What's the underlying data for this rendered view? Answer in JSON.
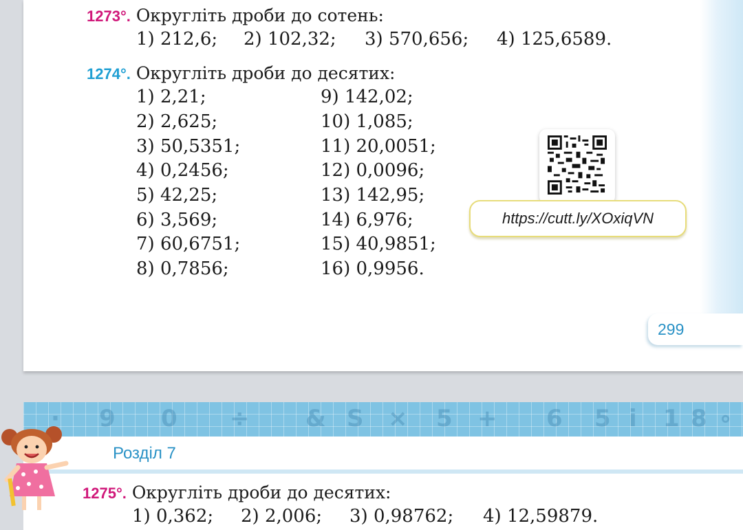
{
  "exercise_1273": {
    "number": "1273°.",
    "title": "Округліть дроби до сотень:",
    "items": [
      "1) 212,6;",
      "2) 102,32;",
      "3) 570,656;",
      "4) 125,6589."
    ]
  },
  "exercise_1274": {
    "number": "1274°.",
    "title": "Округліть дроби до десятих:",
    "left": [
      "1) 2,21;",
      "2) 2,625;",
      "3) 50,5351;",
      "4) 0,2456;",
      "5) 42,25;",
      "6) 3,569;",
      "7) 60,6751;",
      "8) 0,7856;"
    ],
    "right": [
      "9) 142,02;",
      "10) 1,085;",
      "11) 20,0051;",
      "12) 0,0096;",
      "13) 142,95;",
      "14) 6,976;",
      "15) 40,9851;",
      "16) 0,9956."
    ]
  },
  "qr": {
    "url": "https://cutt.ly/XOxiqVN",
    "icon": "qr-code-icon"
  },
  "page_number": "299",
  "section": {
    "label": "Розділ 7"
  },
  "exercise_1275": {
    "number": "1275°.",
    "title": "Округліть дроби до десятих:",
    "items": [
      "1) 0,362;",
      "2) 2,006;",
      "3) 0,98762;",
      "4) 12,59879."
    ]
  },
  "colors": {
    "magenta": "#d0187a",
    "cyan": "#1f9fd3",
    "banner": "#7fc3e3"
  }
}
